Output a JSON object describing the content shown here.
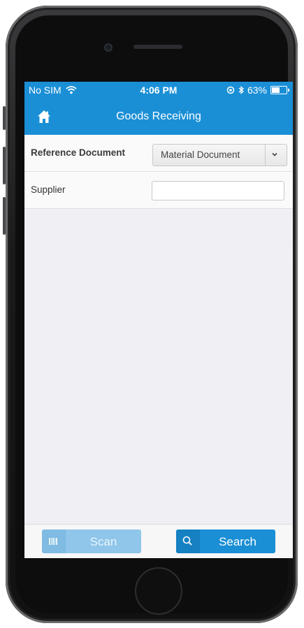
{
  "status_bar": {
    "carrier": "No SIM",
    "time": "4:06 PM",
    "battery": "63%",
    "battery_level": 0.63
  },
  "header": {
    "title": "Goods Receiving",
    "home_icon": "home-icon"
  },
  "form": {
    "reference_document": {
      "label": "Reference Document",
      "selected": "Material Document"
    },
    "supplier": {
      "label": "Supplier",
      "value": "",
      "placeholder": ""
    }
  },
  "actions": {
    "scan_label": "Scan",
    "search_label": "Search"
  },
  "colors": {
    "accent": "#1a8fd6",
    "scan_disabled": "#8fc6ea"
  }
}
